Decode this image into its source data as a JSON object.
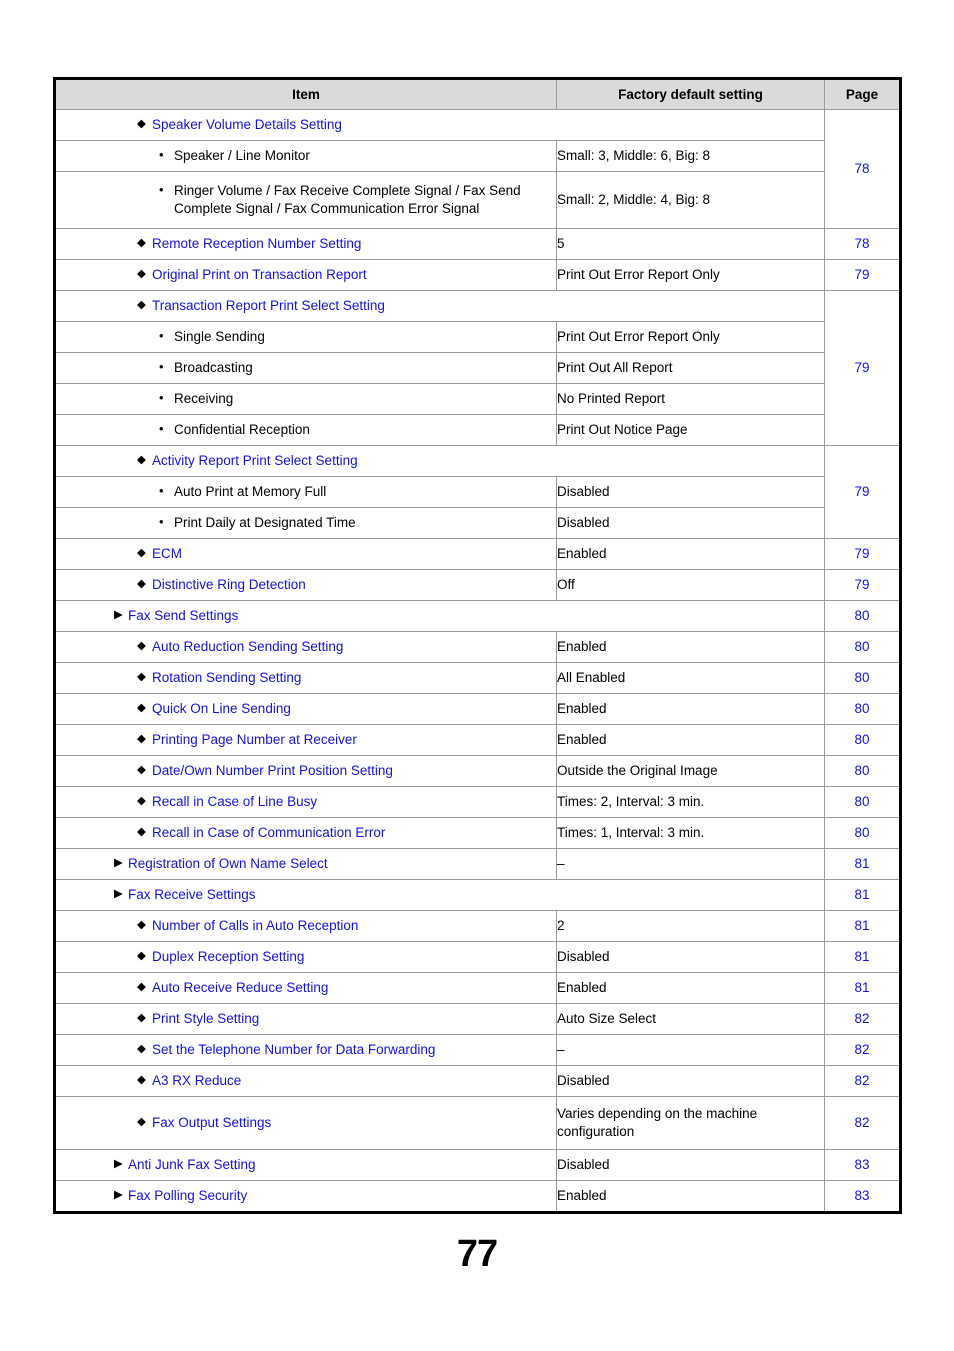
{
  "document": {
    "page_number": "77"
  },
  "table": {
    "headers": {
      "item": "Item",
      "value": "Factory default setting",
      "page": "Page"
    },
    "rows": [
      {
        "level": "diamond",
        "item": "Speaker Volume Details Setting",
        "value": null,
        "page": "78",
        "group": true
      },
      {
        "level": "bullet",
        "item": "Speaker / Line Monitor",
        "value": "Small: 3, Middle: 6, Big: 8",
        "page": null
      },
      {
        "level": "bullet",
        "item": "Ringer Volume / Fax Receive Complete Signal / Fax Send Complete Signal / Fax Communication Error Signal",
        "value": "Small: 2, Middle: 4, Big: 8",
        "page": null
      },
      {
        "level": "diamond",
        "item": "Remote Reception Number Setting",
        "value": "5",
        "page": "78"
      },
      {
        "level": "diamond",
        "item": "Original Print on Transaction Report",
        "value": "Print Out Error Report Only",
        "page": "79"
      },
      {
        "level": "diamond",
        "item": "Transaction Report Print Select Setting",
        "value": null,
        "page": "79",
        "group": true
      },
      {
        "level": "bullet",
        "item": "Single Sending",
        "value": "Print Out Error Report Only",
        "page": null
      },
      {
        "level": "bullet",
        "item": "Broadcasting",
        "value": "Print Out All Report",
        "page": null
      },
      {
        "level": "bullet",
        "item": "Receiving",
        "value": "No Printed Report",
        "page": null
      },
      {
        "level": "bullet",
        "item": "Confidential Reception",
        "value": "Print Out Notice Page",
        "page": null
      },
      {
        "level": "diamond",
        "item": "Activity Report Print Select Setting",
        "value": null,
        "page": "79",
        "group": true
      },
      {
        "level": "bullet",
        "item": "Auto Print at Memory Full",
        "value": "Disabled",
        "page": null
      },
      {
        "level": "bullet",
        "item": "Print Daily at Designated Time",
        "value": "Disabled",
        "page": null
      },
      {
        "level": "diamond",
        "item": "ECM",
        "value": "Enabled",
        "page": "79"
      },
      {
        "level": "diamond",
        "item": "Distinctive Ring Detection",
        "value": "Off",
        "page": "79"
      },
      {
        "level": "triangle",
        "item": "Fax Send Settings",
        "value": null,
        "page": "80",
        "group": true
      },
      {
        "level": "diamond",
        "item": "Auto Reduction Sending Setting",
        "value": "Enabled",
        "page": "80"
      },
      {
        "level": "diamond",
        "item": "Rotation Sending Setting",
        "value": "All Enabled",
        "page": "80"
      },
      {
        "level": "diamond",
        "item": "Quick On Line Sending",
        "value": "Enabled",
        "page": "80"
      },
      {
        "level": "diamond",
        "item": "Printing Page Number at Receiver",
        "value": "Enabled",
        "page": "80"
      },
      {
        "level": "diamond",
        "item": "Date/Own Number Print Position Setting",
        "value": "Outside the Original Image",
        "page": "80"
      },
      {
        "level": "diamond",
        "item": "Recall in Case of Line Busy",
        "value": "Times: 2, Interval: 3 min.",
        "page": "80"
      },
      {
        "level": "diamond",
        "item": "Recall in Case of Communication Error",
        "value": "Times: 1, Interval: 3 min.",
        "page": "80"
      },
      {
        "level": "triangle",
        "item": "Registration of Own Name Select",
        "value": "–",
        "page": "81"
      },
      {
        "level": "triangle",
        "item": "Fax Receive Settings",
        "value": null,
        "page": "81",
        "group": true
      },
      {
        "level": "diamond",
        "item": "Number of Calls in Auto Reception",
        "value": "2",
        "page": "81"
      },
      {
        "level": "diamond",
        "item": "Duplex Reception Setting",
        "value": "Disabled",
        "page": "81"
      },
      {
        "level": "diamond",
        "item": "Auto Receive Reduce Setting",
        "value": "Enabled",
        "page": "81"
      },
      {
        "level": "diamond",
        "item": "Print Style Setting",
        "value": "Auto Size Select",
        "page": "82"
      },
      {
        "level": "diamond",
        "item": "Set the Telephone Number for Data Forwarding",
        "value": "–",
        "page": "82"
      },
      {
        "level": "diamond",
        "item": "A3 RX Reduce",
        "value": "Disabled",
        "page": "82"
      },
      {
        "level": "diamond",
        "item": "Fax Output Settings",
        "value": "Varies depending on the machine configuration",
        "page": "82"
      },
      {
        "level": "triangle",
        "item": "Anti Junk Fax Setting",
        "value": "Disabled",
        "page": "83"
      },
      {
        "level": "triangle",
        "item": "Fax Polling Security",
        "value": "Enabled",
        "page": "83"
      }
    ],
    "markers": {
      "triangle": "▶",
      "diamond": "◆",
      "bullet": "•"
    },
    "page_spans": [
      {
        "start": 0,
        "span": 3,
        "page": "78"
      },
      {
        "start": 3,
        "span": 1,
        "page": "78"
      },
      {
        "start": 4,
        "span": 1,
        "page": "79"
      },
      {
        "start": 5,
        "span": 5,
        "page": "79"
      },
      {
        "start": 10,
        "span": 3,
        "page": "79"
      },
      {
        "start": 13,
        "span": 1,
        "page": "79"
      },
      {
        "start": 14,
        "span": 1,
        "page": "79"
      },
      {
        "start": 15,
        "span": 1,
        "page": "80"
      },
      {
        "start": 16,
        "span": 1,
        "page": "80"
      },
      {
        "start": 17,
        "span": 1,
        "page": "80"
      },
      {
        "start": 18,
        "span": 1,
        "page": "80"
      },
      {
        "start": 19,
        "span": 1,
        "page": "80"
      },
      {
        "start": 20,
        "span": 1,
        "page": "80"
      },
      {
        "start": 21,
        "span": 1,
        "page": "80"
      },
      {
        "start": 22,
        "span": 1,
        "page": "80"
      },
      {
        "start": 23,
        "span": 1,
        "page": "81"
      },
      {
        "start": 24,
        "span": 1,
        "page": "81"
      },
      {
        "start": 25,
        "span": 1,
        "page": "81"
      },
      {
        "start": 26,
        "span": 1,
        "page": "81"
      },
      {
        "start": 27,
        "span": 1,
        "page": "81"
      },
      {
        "start": 28,
        "span": 1,
        "page": "82"
      },
      {
        "start": 29,
        "span": 1,
        "page": "82"
      },
      {
        "start": 30,
        "span": 1,
        "page": "82"
      },
      {
        "start": 31,
        "span": 1,
        "page": "82"
      },
      {
        "start": 32,
        "span": 1,
        "page": "83"
      },
      {
        "start": 33,
        "span": 1,
        "page": "83"
      }
    ],
    "colors": {
      "link": "#1313d8",
      "header_bg": "#dadada",
      "border": "#9a9a9a",
      "outer_border": "#000000"
    }
  }
}
